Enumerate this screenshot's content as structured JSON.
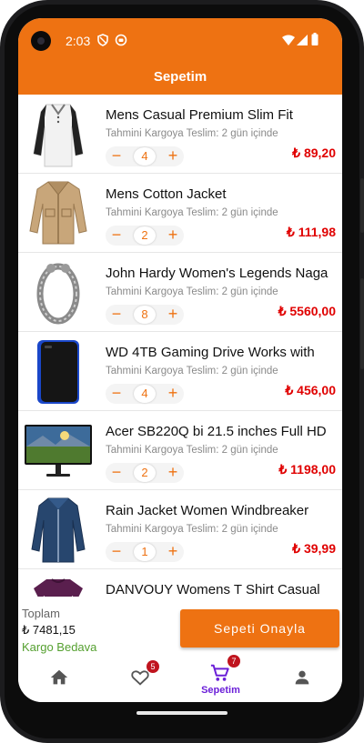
{
  "status_bar": {
    "time": "2:03"
  },
  "app_bar": {
    "title": "Sepetim"
  },
  "colors": {
    "accent": "#ee7212",
    "price": "#e00000",
    "nav_active": "#6b1fd8",
    "badge": "#c0141e",
    "shipping": "#55a030"
  },
  "cart": {
    "items": [
      {
        "name": "Mens Casual Premium Slim Fit",
        "subtitle": "Tahmini Kargoya Teslim: 2 gün içinde",
        "qty": "4",
        "price": "₺ 89,20",
        "image_icon": "raglan-shirt-icon"
      },
      {
        "name": "Mens Cotton Jacket",
        "subtitle": "Tahmini Kargoya Teslim: 2 gün içinde",
        "qty": "2",
        "price": "₺ 111,98",
        "image_icon": "cotton-jacket-icon"
      },
      {
        "name": "John Hardy Women's Legends Naga",
        "subtitle": "Tahmini Kargoya Teslim: 2 gün içinde",
        "qty": "8",
        "price": "₺ 5560,00",
        "image_icon": "bracelet-icon"
      },
      {
        "name": "WD 4TB Gaming Drive Works with",
        "subtitle": "Tahmini Kargoya Teslim: 2 gün içinde",
        "qty": "4",
        "price": "₺ 456,00",
        "image_icon": "hard-drive-icon"
      },
      {
        "name": "Acer SB220Q bi 21.5 inches Full HD",
        "subtitle": "Tahmini Kargoya Teslim: 2 gün içinde",
        "qty": "2",
        "price": "₺ 1198,00",
        "image_icon": "monitor-icon"
      },
      {
        "name": "Rain Jacket Women Windbreaker",
        "subtitle": "Tahmini Kargoya Teslim: 2 gün içinde",
        "qty": "1",
        "price": "₺ 39,99",
        "image_icon": "rain-jacket-icon"
      },
      {
        "name": "DANVOUY Womens T Shirt Casual",
        "subtitle": "",
        "qty": "",
        "price": "",
        "image_icon": "tshirt-icon"
      }
    ]
  },
  "footer": {
    "total_label": "Toplam",
    "total_value": "₺ 7481,15",
    "shipping_label": "Kargo Bedava",
    "confirm_button": "Sepeti Onayla"
  },
  "bottom_nav": {
    "items": [
      {
        "icon": "home-icon",
        "label": "",
        "badge": ""
      },
      {
        "icon": "heart-icon",
        "label": "",
        "badge": "5"
      },
      {
        "icon": "cart-icon",
        "label": "Sepetim",
        "badge": "7"
      },
      {
        "icon": "person-icon",
        "label": "",
        "badge": ""
      }
    ]
  }
}
